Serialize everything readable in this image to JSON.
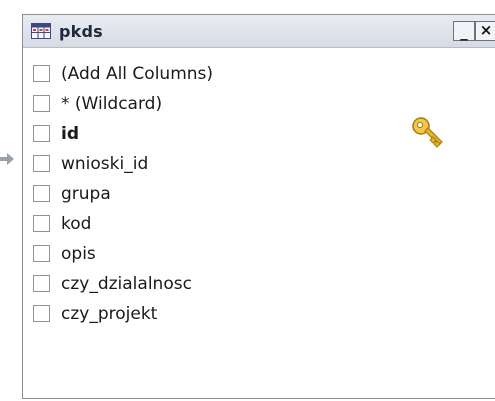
{
  "window": {
    "title": "pkds",
    "minimize_glyph": "_",
    "close_glyph": "×"
  },
  "columns": [
    {
      "label": "(Add All Columns)",
      "bold": false,
      "checked": false
    },
    {
      "label": "* (Wildcard)",
      "bold": false,
      "checked": false
    },
    {
      "label": "id",
      "bold": true,
      "checked": false,
      "primary_key": true
    },
    {
      "label": "wnioski_id",
      "bold": false,
      "checked": false
    },
    {
      "label": "grupa",
      "bold": false,
      "checked": false
    },
    {
      "label": "kod",
      "bold": false,
      "checked": false
    },
    {
      "label": "opis",
      "bold": false,
      "checked": false
    },
    {
      "label": "czy_dzialalnosc",
      "bold": false,
      "checked": false
    },
    {
      "label": "czy_projekt",
      "bold": false,
      "checked": false
    }
  ],
  "icons": {
    "table": "table-icon",
    "primary_key": "key-icon",
    "relation_arrow": "arrow-right-icon"
  },
  "colors": {
    "titlebar": "#dfe3ea",
    "key_gold": "#e8b42a"
  }
}
